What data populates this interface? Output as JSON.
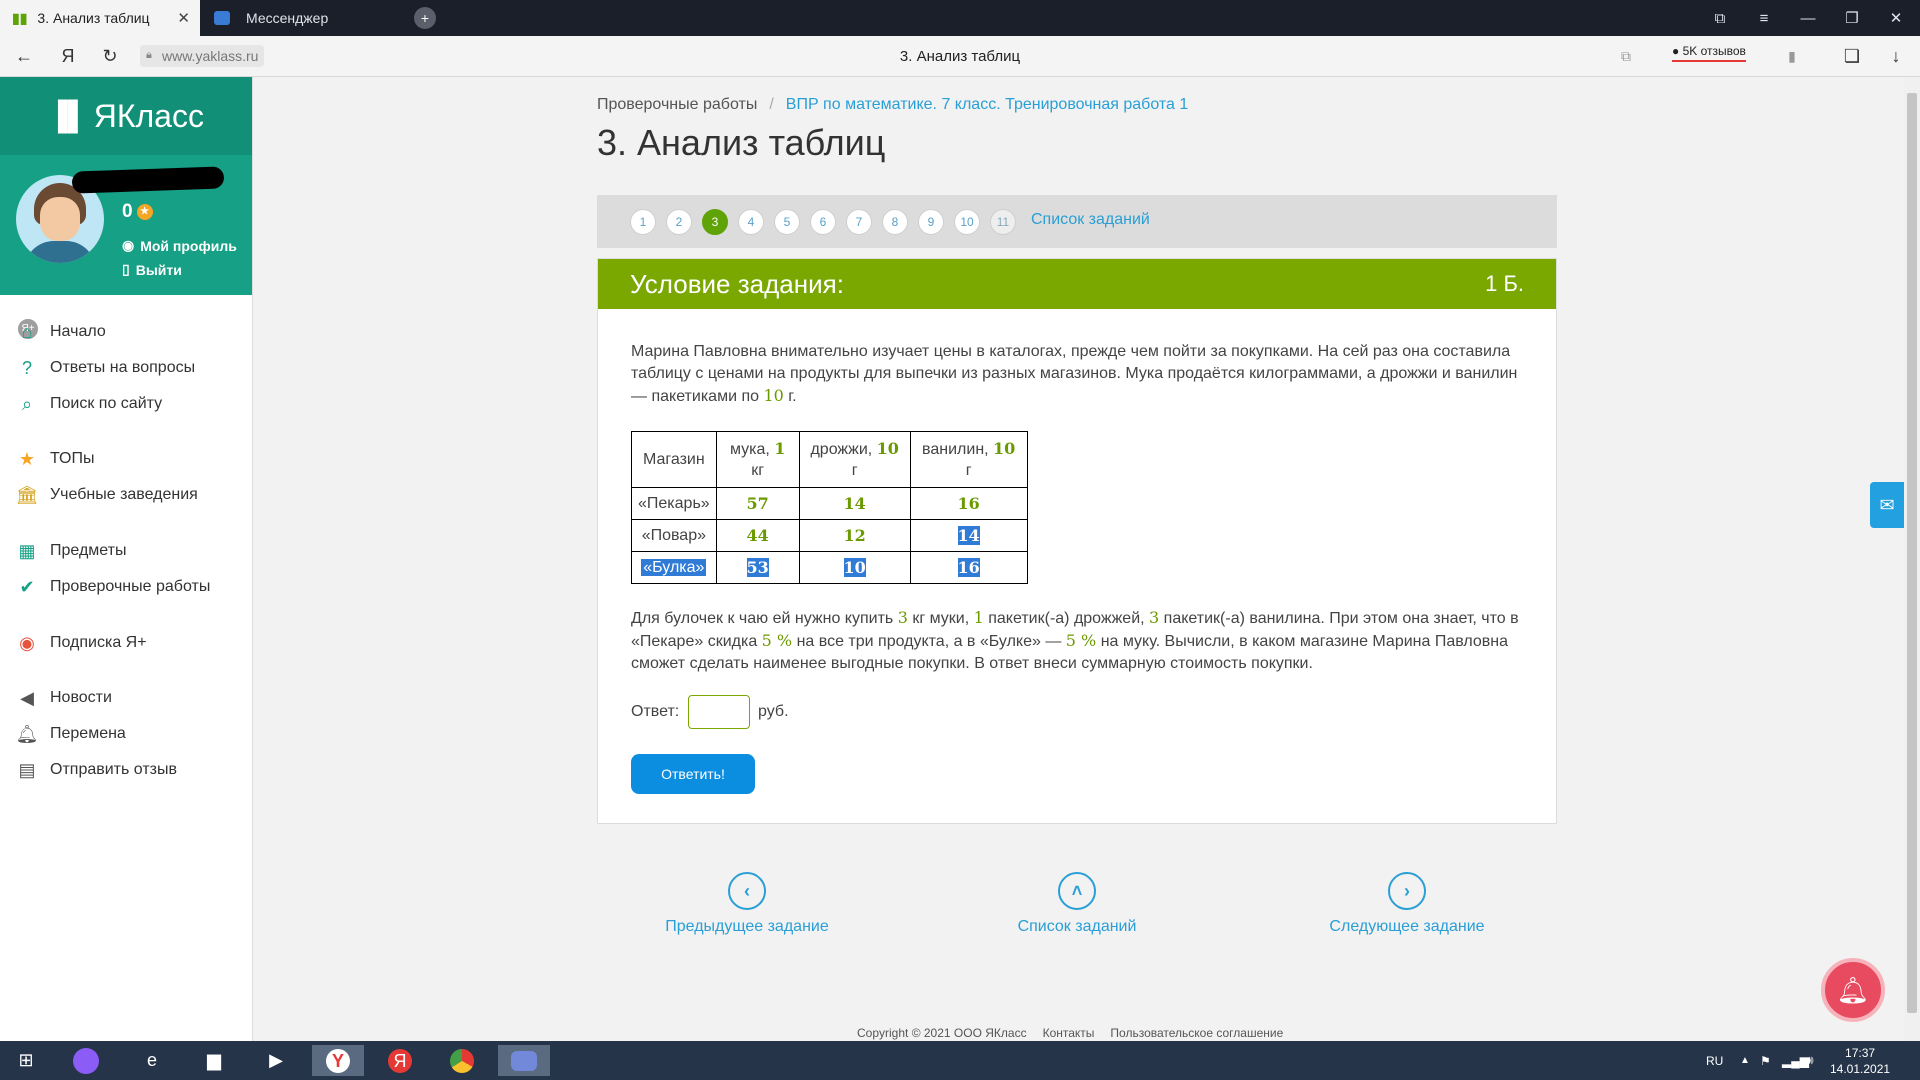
{
  "browser": {
    "tabs": [
      {
        "title": "3. Анализ таблиц",
        "active": true
      },
      {
        "title": "Мессенджер",
        "active": false
      }
    ],
    "url": "www.yaklass.ru",
    "page_title": "3. Анализ таблиц",
    "reviews_label": "5K отзывов",
    "nav_logo": "Я"
  },
  "sidebar": {
    "logo": "ЯКласс",
    "points": "0",
    "profile_link": "Мой профиль",
    "logout_link": "Выйти",
    "menu": [
      {
        "label": "Начало",
        "icon": "home-icon"
      },
      {
        "label": "Ответы на вопросы",
        "icon": "question-icon"
      },
      {
        "label": "Поиск по сайту",
        "icon": "search-icon"
      },
      {
        "label": "ТОПы",
        "icon": "star-icon"
      },
      {
        "label": "Учебные заведения",
        "icon": "school-icon"
      },
      {
        "label": "Предметы",
        "icon": "subjects-icon"
      },
      {
        "label": "Проверочные работы",
        "icon": "check-icon"
      },
      {
        "label": "Подписка Я+",
        "icon": "subscription-icon"
      },
      {
        "label": "Новости",
        "icon": "news-icon"
      },
      {
        "label": "Переменa",
        "icon": "bell-icon"
      },
      {
        "label": "Отправить отзыв",
        "icon": "feedback-icon"
      }
    ]
  },
  "breadcrumb": {
    "parent": "Проверочные работы",
    "current": "ВПР по математике. 7 класс. Тренировочная работа 1"
  },
  "title": "3. Анализ таблиц",
  "task_nav": {
    "numbers": [
      "1",
      "2",
      "3",
      "4",
      "5",
      "6",
      "7",
      "8",
      "9",
      "10",
      "11"
    ],
    "current": "3",
    "list_link": "Список заданий"
  },
  "task": {
    "header": "Условие задания:",
    "points": "1 Б.",
    "intro_a": "Марина Павловна внимательно изучает цены в каталогах, прежде чем пойти за покупками. На сей раз она составила таблицу с ценами на продукты для выпечки из разных магазинов. Мука продаётся килограммами, а дрожжи и ванилин — пакетиками по ",
    "intro_num": "10",
    "intro_b": " г.",
    "table": {
      "headers": [
        {
          "text": "Магазин",
          "num": "",
          "unit": ""
        },
        {
          "text": "мука, ",
          "num": "1",
          "unit": "кг"
        },
        {
          "text": "дрожжи, ",
          "num": "10",
          "unit": "г"
        },
        {
          "text": "ванилин, ",
          "num": "10",
          "unit": "г"
        }
      ],
      "rows": [
        {
          "store": "«Пекарь»",
          "values": [
            "57",
            "14",
            "16"
          ]
        },
        {
          "store": "«Повар»",
          "values": [
            "44",
            "12",
            "14"
          ]
        },
        {
          "store": "«Булка»",
          "values": [
            "53",
            "10",
            "16"
          ]
        }
      ]
    },
    "q": {
      "p1": "Для булочек к чаю ей нужно купить ",
      "n1": "3",
      "p2": " кг муки, ",
      "n2": "1",
      "p3": " пакетик(-а) дрожжей, ",
      "n3": "3",
      "p4": " пакетик(-а) ванилина. При этом она знает, что в «Пекаре» скидка ",
      "n4": "5 %",
      "p5": " на все три продукта, а в «Булке» — ",
      "n5": "5 %",
      "p6": " на муку. Вычисли, в каком магазине Марина Павловна сможет сделать наименее выгодные покупки. В ответ внеси суммарную стоимость покупки."
    },
    "answer_label": "Ответ:",
    "answer_value": "",
    "answer_unit": "руб.",
    "submit": "Ответить!"
  },
  "bottom_nav": {
    "prev": "Предыдущее задание",
    "list": "Список заданий",
    "next": "Следующее задание"
  },
  "footer": {
    "copyright": "Copyright © 2021 ООО ЯКласс",
    "contacts": "Контакты",
    "agreement": "Пользовательское соглашение"
  },
  "taskbar": {
    "lang": "RU",
    "time": "17:37",
    "date": "14.01.2021"
  },
  "colors": {
    "accent_green": "#7aa800",
    "brand_teal": "#16a085",
    "link_blue": "#2a9fd6",
    "button_blue": "#0b8de0"
  }
}
